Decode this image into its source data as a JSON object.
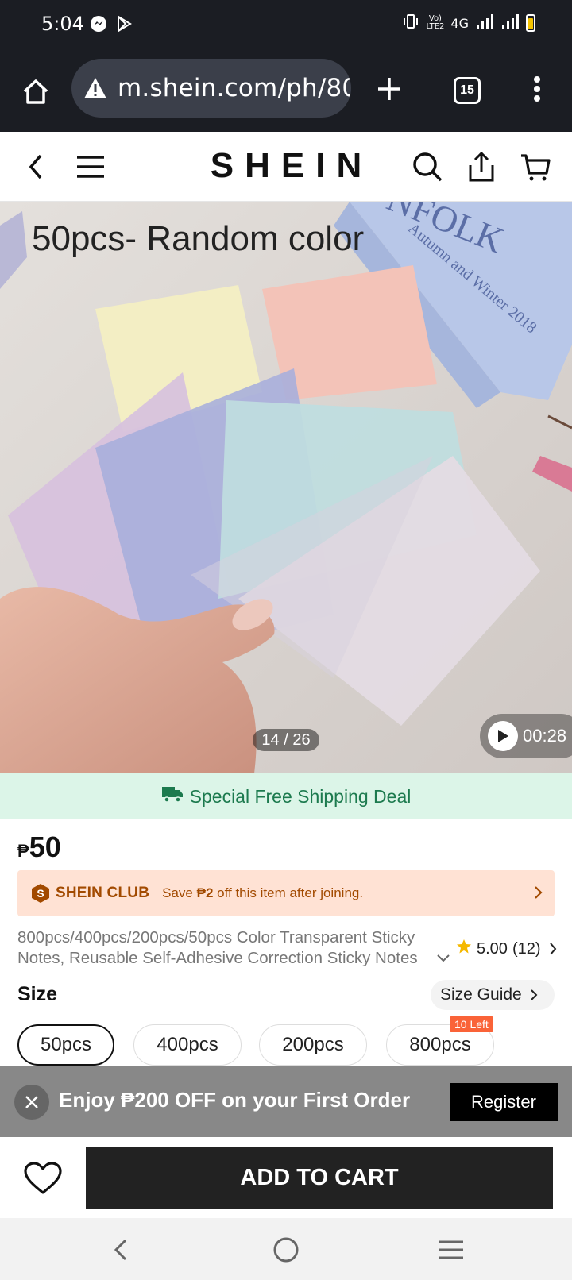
{
  "status_bar": {
    "time": "5:04",
    "network": "4G",
    "lte_line1": "Vo)",
    "lte_line2": "LTE2",
    "icons": [
      "messenger-icon",
      "play-store-icon",
      "vibrate-icon",
      "signal-icon",
      "battery-icon"
    ]
  },
  "browser": {
    "url": "m.shein.com/ph/80C",
    "tab_count": "15",
    "icons": [
      "home-icon",
      "warning-icon",
      "new-tab-icon",
      "menu-dots-icon"
    ]
  },
  "header": {
    "logo": "SHEIN",
    "icons": [
      "back-icon",
      "hamburger-icon",
      "search-icon",
      "share-icon",
      "cart-icon"
    ]
  },
  "gallery": {
    "caption": "50pcs- Random color",
    "counter": "14 / 26",
    "video_duration": "00:28"
  },
  "shipping": {
    "label": "Special Free Shipping Deal",
    "color": "#1c7a4e"
  },
  "product": {
    "currency": "₱",
    "price": "50",
    "title": "800pcs/400pcs/200pcs/50pcs Color Transparent Sticky Notes, Reusable Self-Adhesive Correction Sticky Notes",
    "rating": "5.00",
    "reviews": "(12)"
  },
  "club": {
    "name": "SHEIN CLUB",
    "text_prefix": "Save ",
    "amount": "₱2",
    "text_suffix": " off this item after joining."
  },
  "size": {
    "label": "Size",
    "guide": "Size Guide",
    "options": [
      "50pcs",
      "400pcs",
      "200pcs",
      "800pcs"
    ],
    "selected": "50pcs",
    "stock_badge": "10 Left"
  },
  "promo": {
    "text": "Enjoy ₱200 OFF on your First Order",
    "register": "Register"
  },
  "actions": {
    "add_to_cart": "ADD TO CART"
  }
}
